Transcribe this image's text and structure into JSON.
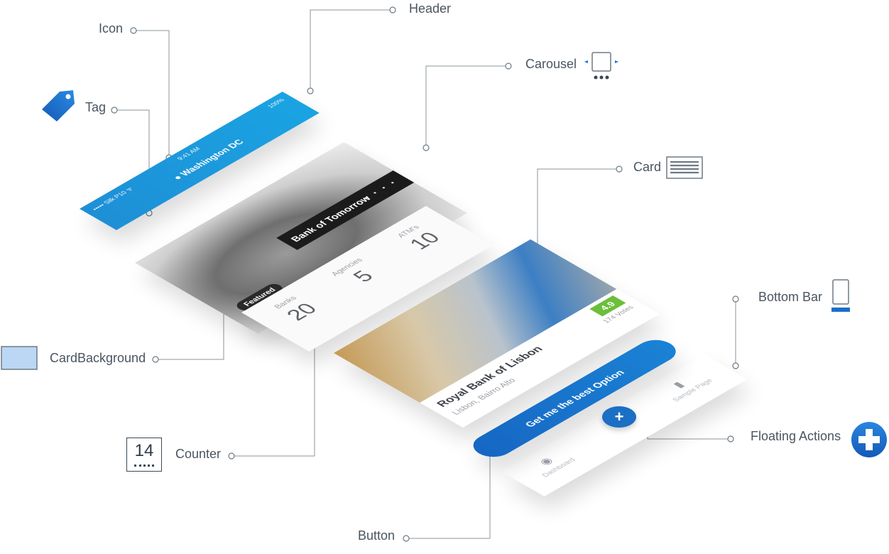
{
  "callouts": {
    "header": "Header",
    "icon": "Icon",
    "carousel": "Carousel",
    "tag": "Tag",
    "card": "Card",
    "bottom_bar": "Bottom Bar",
    "card_background": "CardBackground",
    "counter": "Counter",
    "floating_actions": "Floating Actions",
    "button": "Button"
  },
  "legend_counter_digit": "14",
  "header": {
    "carrier": "••••• Silk P10 ᯤ",
    "time": "9:41 AM",
    "battery": "100%",
    "location": "Washington DC",
    "location_icon": "map-pin-icon"
  },
  "carousel": {
    "title": "Bank of Tomorrow",
    "tag": "Featured",
    "dots": "• • • •"
  },
  "counters": [
    {
      "label": "Banks",
      "value": "20"
    },
    {
      "label": "Agencies",
      "value": "5"
    },
    {
      "label": "ATM's",
      "value": "10"
    }
  ],
  "card": {
    "title": "Royal Bank of Lisbon",
    "subtitle": "Lisbon, Bairro Alto",
    "rating": "4.9",
    "votes": "174 Votes"
  },
  "button": {
    "label": "Get me the best Option"
  },
  "fab": {
    "symbol": "+"
  },
  "bottom_bar": {
    "tabs": [
      {
        "label": "Dashboard",
        "icon": "dashboard-icon"
      },
      {
        "label": "Sample Page",
        "icon": "folder-icon"
      }
    ]
  },
  "colors": {
    "primary_blue": "#1a82d4",
    "dark_blue": "#1667c4",
    "rating_green": "#6bbf3a",
    "label_gray": "#4a5560",
    "line_gray": "#7a8690"
  }
}
